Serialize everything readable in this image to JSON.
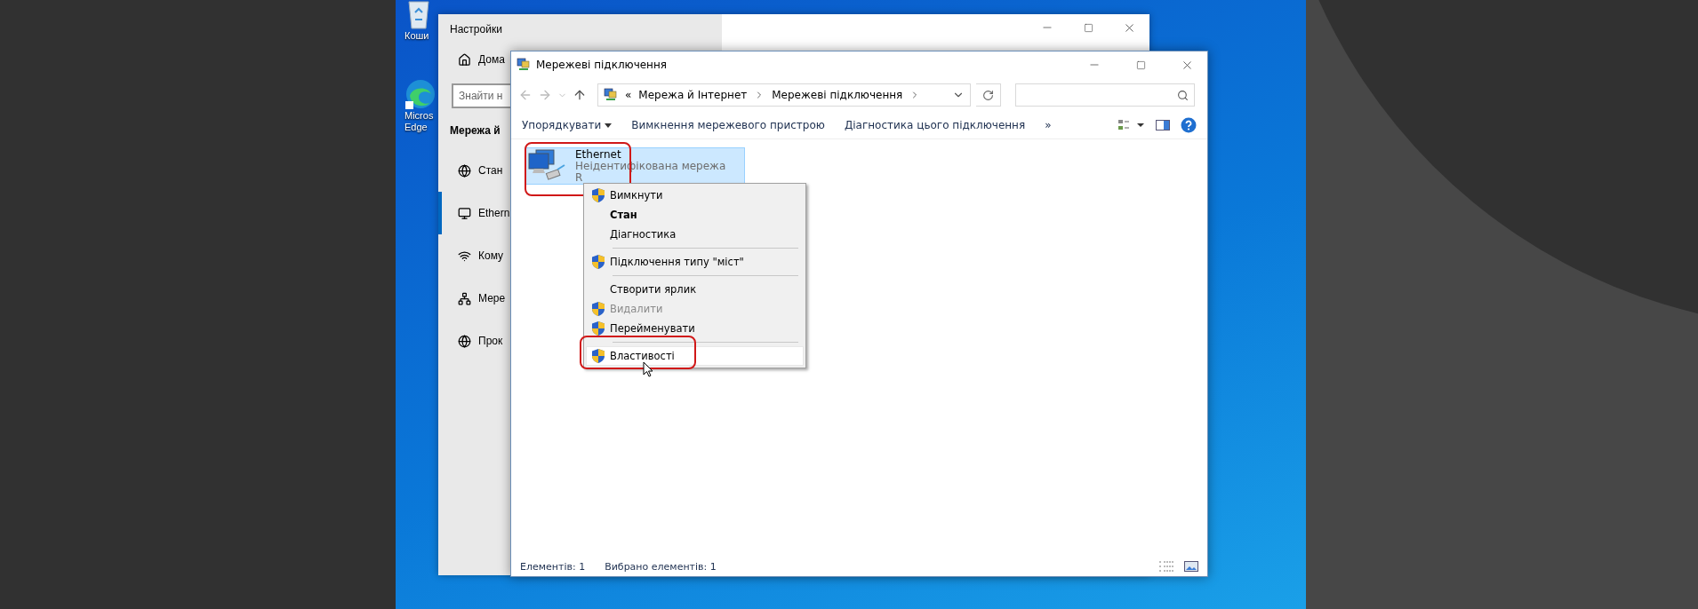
{
  "desktop": {
    "icons": [
      {
        "label_lines": [
          "Коши"
        ]
      },
      {
        "label_lines": [
          "Micros",
          "Edge"
        ]
      }
    ]
  },
  "settings": {
    "title": "Настройки",
    "home": "Дома",
    "search": {
      "placeholder": "Знайти н"
    },
    "section": "Мережа й",
    "nav": [
      {
        "label": "Стан",
        "selected": false
      },
      {
        "label": "Ethern",
        "selected": true
      },
      {
        "label": "Кому",
        "selected": false
      },
      {
        "label": "Мере",
        "selected": false
      },
      {
        "label": "Прок",
        "selected": false
      }
    ]
  },
  "explorer": {
    "title": "Мережеві підключення",
    "address": {
      "prefix": "«",
      "crumbs": [
        "Мережа й Інтернет",
        "Мережеві підключення"
      ]
    },
    "toolbar": {
      "organize": "Упорядкувати",
      "commands": [
        "Вимкнення мережевого пристрою",
        "Діагностика цього підключення"
      ],
      "more": "»"
    },
    "items": [
      {
        "name": "Ethernet",
        "lines": [
          "Неідентифікована мережа",
          "R"
        ],
        "selected": true
      }
    ],
    "status_bar": [
      "Елементів: 1",
      "Вибрано елементів: 1"
    ]
  },
  "context_menu": {
    "items": [
      {
        "kind": "item",
        "label": "Вимкнути",
        "shield": true,
        "bold": false,
        "disabled": false,
        "selected": false
      },
      {
        "kind": "item",
        "label": "Стан",
        "shield": false,
        "bold": true,
        "disabled": false,
        "selected": false
      },
      {
        "kind": "item",
        "label": "Діагностика",
        "shield": false,
        "bold": false,
        "disabled": false,
        "selected": false
      },
      {
        "kind": "separator"
      },
      {
        "kind": "item",
        "label": "Підключення типу \"міст\"",
        "shield": true,
        "bold": false,
        "disabled": false,
        "selected": false
      },
      {
        "kind": "separator"
      },
      {
        "kind": "item",
        "label": "Створити ярлик",
        "shield": false,
        "bold": false,
        "disabled": false,
        "selected": false
      },
      {
        "kind": "item",
        "label": "Видалити",
        "shield": true,
        "bold": false,
        "disabled": true,
        "selected": false
      },
      {
        "kind": "item",
        "label": "Перейменувати",
        "shield": true,
        "bold": false,
        "disabled": false,
        "selected": false
      },
      {
        "kind": "separator"
      },
      {
        "kind": "item",
        "label": "Властивості",
        "shield": true,
        "bold": false,
        "disabled": false,
        "selected": true
      }
    ]
  }
}
